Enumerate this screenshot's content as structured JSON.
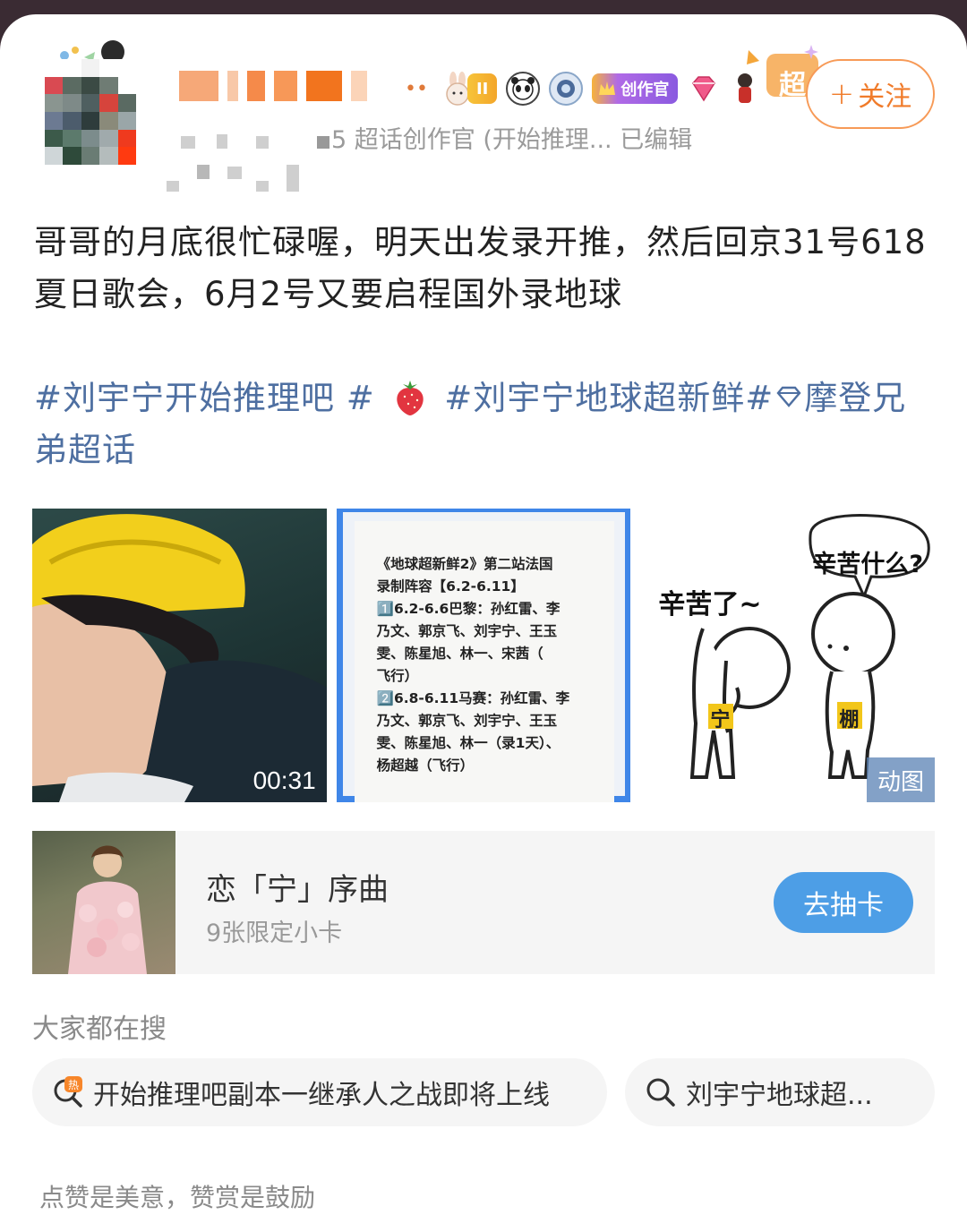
{
  "header": {
    "meta_line": "5  超话创作官 (开始推理...  已编辑",
    "badges": {
      "level_badge": "II",
      "creator_badge": "创作官",
      "super_badge": "超"
    },
    "follow_button": "关注"
  },
  "post": {
    "text": "哥哥的月底很忙碌喔，明天出发录开推，然后回京31号618夏日歌会，6月2号又要启程国外录地球",
    "topics_part1": "#刘宇宁开始推理吧 #",
    "topics_part2": "#刘宇宁地球超新鲜#",
    "topics_part3": "摩登兄弟超话"
  },
  "media": {
    "video_duration": "00:31",
    "doc_lines": [
      "《地球超新鲜2》第二站法国",
      "录制阵容【6.2-6.11】",
      "1️⃣6.2-6.6巴黎：孙红雷、李",
      "乃文、郭京飞、刘宇宁、王玉",
      "雯、陈星旭、林一、宋茜（",
      "飞行）",
      "2️⃣6.8-6.11马赛：孙红雷、李",
      "乃文、郭京飞、刘宇宁、王玉",
      "雯、陈星旭、林一（录1天）、",
      "杨超越（飞行）"
    ],
    "gif_left_text": "辛苦了~",
    "gif_bubble_text": "辛苦什么?",
    "gif_left_char": "宁",
    "gif_right_char": "棚",
    "gif_tag": "动图"
  },
  "promo": {
    "title": "恋「宁」序曲",
    "subtitle": "9张限定小卡",
    "button": "去抽卡"
  },
  "search": {
    "title": "大家都在搜",
    "items": [
      {
        "label": "开始推理吧副本一继承人之战即将上线",
        "icon": "hot-search-icon"
      },
      {
        "label": "刘宇宁地球超...",
        "icon": "search-icon"
      }
    ]
  },
  "reward_hint": "点赞是美意，赞赏是鼓励",
  "colors": {
    "accent_orange": "#f07b2a",
    "topic_blue": "#4e6fa1",
    "button_blue": "#4d9ee6",
    "doc_border_blue": "#3f86e8"
  }
}
